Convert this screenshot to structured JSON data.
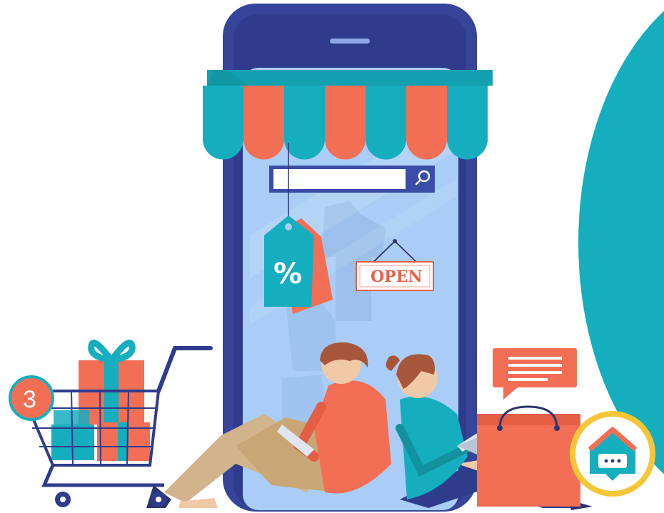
{
  "open_sign": {
    "label": "OPEN"
  },
  "discount_tag": {
    "label": "%"
  },
  "cart": {
    "item_count": "3"
  },
  "search": {
    "value": "",
    "icon": "search-icon"
  },
  "chat_app_icon": {
    "icon": "house-chat-icon"
  },
  "colors": {
    "teal": "#15aebe",
    "coral": "#f26f55",
    "phone_frame": "#36459a",
    "screen": "#a9cdf6",
    "gold": "#f4c738"
  }
}
